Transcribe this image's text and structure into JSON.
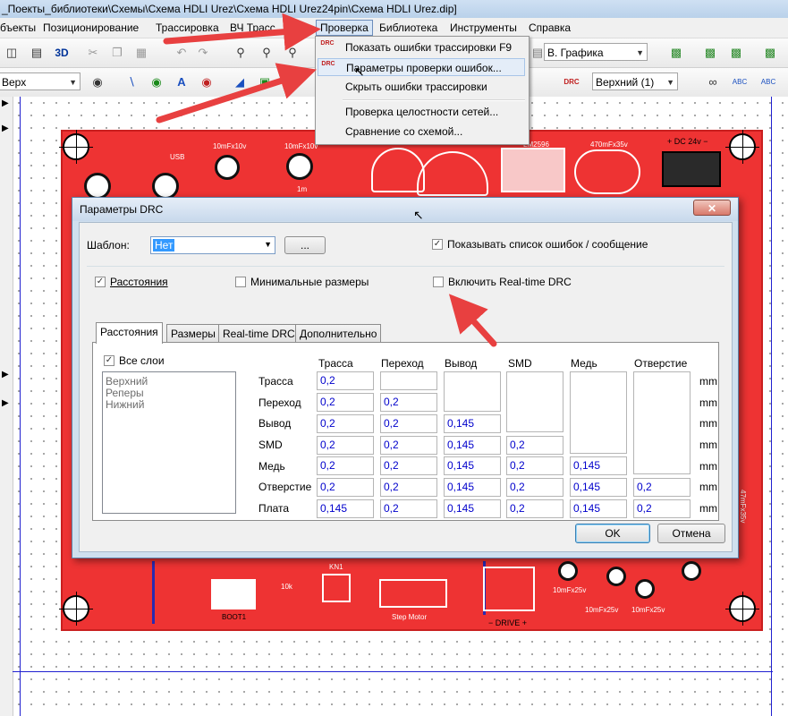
{
  "window": {
    "title": "_Поекты_библиотеки\\Схемы\\Схема HDLI Urez\\Схема HDLI Urez24pin\\Схема HDLI Urez.dip]"
  },
  "menubar": {
    "items": [
      {
        "label": "бъекты"
      },
      {
        "label": "Позиционирование"
      },
      {
        "label": "Трассировка"
      },
      {
        "label": "ВЧ Трасс"
      },
      {
        "label": "Проверка"
      },
      {
        "label": "Библиотека"
      },
      {
        "label": "Инструменты"
      },
      {
        "label": "Справка"
      }
    ]
  },
  "toolbar1": {
    "view3d": "3D",
    "graphics_combo": "В. Графика"
  },
  "toolbar2": {
    "layer_combo": "Верх",
    "layer_combo_right": "Верхний (1)"
  },
  "dropdown": {
    "items": [
      {
        "icon": "DRC",
        "label": "Показать ошибки трассировки F9"
      },
      {
        "icon": "DRC",
        "label": "Параметры проверки ошибок..."
      },
      {
        "icon": "",
        "label": "Скрыть ошибки трассировки"
      },
      {
        "icon": "",
        "label": "Проверка целостности сетей..."
      },
      {
        "icon": "",
        "label": "Сравнение со схемой..."
      }
    ]
  },
  "pcb": {
    "silk": [
      "USB",
      "10mFx10v",
      "10mFx10v",
      "1m",
      "LM2596",
      "470mFx35v",
      "+ DC 24v −",
      "KN1",
      "10k",
      "Step Motor",
      "BOOT1",
      "10mFx25v",
      "10mFx25v",
      "10mFx25v",
      "− DRIVE +",
      "47mFx35v"
    ]
  },
  "dialog": {
    "title": "Параметры DRC",
    "close": "✕",
    "template_label": "Шаблон:",
    "template_value": "Нет",
    "browse_button": "...",
    "show_errors_label": "Показывать список ошибок / сообщение",
    "show_errors_checked": true,
    "cb_clearances_label": "Расстояния",
    "cb_clearances_checked": true,
    "cb_min_sizes_label": "Минимальные размеры",
    "cb_min_sizes_checked": false,
    "cb_realtime_label": "Включить Real-time DRC",
    "cb_realtime_checked": false,
    "tabs": [
      "Расстояния",
      "Размеры",
      "Real-time DRC",
      "Дополнительно"
    ],
    "all_layers_label": "Все слои",
    "all_layers_checked": true,
    "layers": [
      "Верхний",
      "Реперы",
      "Нижний"
    ],
    "columns": [
      "Трасса",
      "Переход",
      "Вывод",
      "SMD",
      "Медь",
      "Отверстие"
    ],
    "rows": [
      {
        "label": "Трасса",
        "values": [
          "0,2",
          "",
          "",
          "",
          "",
          ""
        ]
      },
      {
        "label": "Переход",
        "values": [
          "0,2",
          "0,2",
          "",
          "",
          "",
          ""
        ]
      },
      {
        "label": "Вывод",
        "values": [
          "0,2",
          "0,2",
          "0,145",
          "",
          "",
          ""
        ]
      },
      {
        "label": "SMD",
        "values": [
          "0,2",
          "0,2",
          "0,145",
          "0,2",
          "",
          ""
        ]
      },
      {
        "label": "Медь",
        "values": [
          "0,2",
          "0,2",
          "0,145",
          "0,2",
          "0,145",
          ""
        ]
      },
      {
        "label": "Отверстие",
        "values": [
          "0,2",
          "0,2",
          "0,145",
          "0,2",
          "0,145",
          "0,2"
        ]
      },
      {
        "label": "Плата",
        "values": [
          "0,145",
          "0,2",
          "0,145",
          "0,2",
          "0,145",
          "0,2"
        ]
      }
    ],
    "unit": "mm",
    "ok": "OK",
    "cancel": "Отмена"
  },
  "colors": {
    "pcb_red": "#ee3333",
    "trace_blue": "#2a2ab0",
    "arrow_red": "#e84040",
    "cell_text": "#0000cc"
  }
}
